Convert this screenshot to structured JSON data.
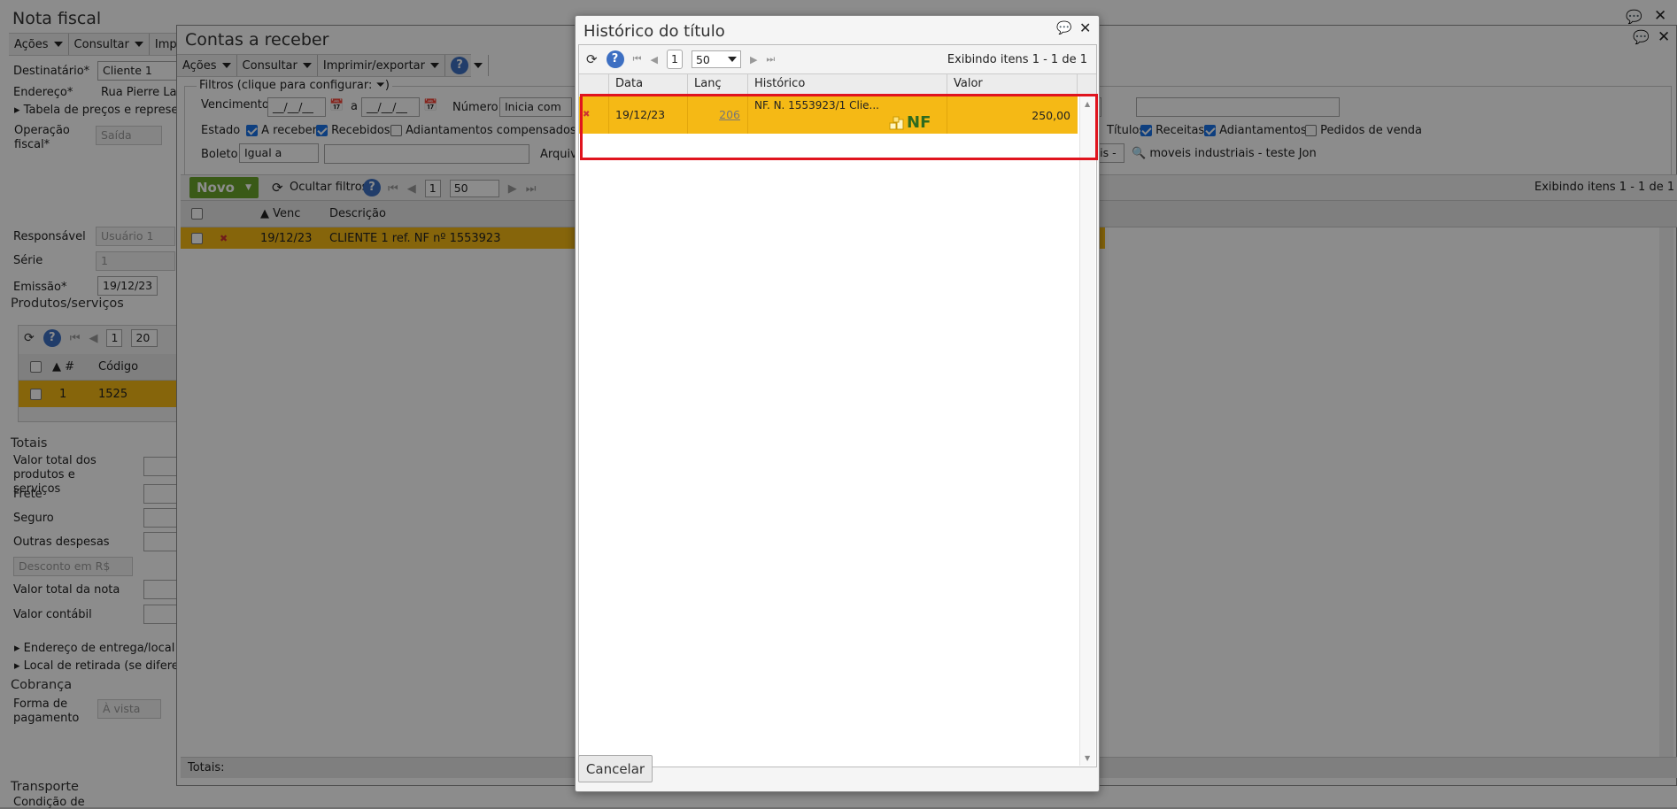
{
  "nota": {
    "title": "Nota fiscal",
    "menu": [
      "Ações",
      "Consultar",
      "Imprimir"
    ],
    "destinatario_label": "Destinatário*",
    "destinatario_value": "Cliente 1",
    "endereco_label": "Endereço*",
    "endereco_value": "Rua Pierre Laf",
    "tabela_label": "Tabela de preços e represen",
    "operacao_label": "Operação fiscal*",
    "operacao_value": "Saída",
    "responsavel_label": "Responsável",
    "responsavel_value": "Usuário 1",
    "serie_label": "Série",
    "serie_value": "1",
    "emissao_label": "Emissão*",
    "emissao_value": "19/12/23",
    "produtos_title": "Produtos/serviços",
    "prod_page": "1",
    "prod_pagesize": "20",
    "prod_col_num": "#",
    "prod_col_codigo": "Código",
    "prod_row_num": "1",
    "prod_row_codigo": "1525",
    "totais_title": "Totais",
    "valor_total_produtos_label": "Valor total dos produtos e serviços",
    "frete_label": "Frete",
    "seguro_label": "Seguro",
    "outras_label": "Outras despesas",
    "desconto_label": "Desconto em R$",
    "valor_total_nota_label": "Valor total da nota",
    "valor_contabil_label": "Valor contábil",
    "entrega_label": "Endereço de entrega/local d",
    "retirada_label": "Local de retirada (se diferen",
    "cobranca_title": "Cobrança",
    "forma_label": "Forma de pagamento",
    "forma_value": "À vista",
    "transporte_title": "Transporte",
    "condicao_label": "Condição de"
  },
  "contas": {
    "title": "Contas a receber",
    "menu": [
      "Ações",
      "Consultar",
      "Imprimir/exportar"
    ],
    "filtros_label": "Filtros (clique para configurar:",
    "vencimento_label": "Vencimento",
    "date_placeholder": "__/__/__",
    "a_label": "a",
    "numero_label": "Número",
    "numero_op": "Inicia com",
    "estado_label": "Estado",
    "estado_opts": [
      {
        "label": "A receber",
        "checked": true
      },
      {
        "label": "Recebidos",
        "checked": true
      },
      {
        "label": "Adiantamentos compensados",
        "checked": false
      }
    ],
    "right_opts": [
      {
        "label": "Títulos",
        "checked": true
      },
      {
        "label": "Receitas",
        "checked": true
      },
      {
        "label": "Adiantamentos",
        "checked": true
      },
      {
        "label": "Pedidos de venda",
        "checked": false
      }
    ],
    "boleto_label": "Boleto",
    "boleto_op": "Igual a",
    "arquivo_label": "Arquiv",
    "industriais_value": "triais -",
    "search_value": "moveis industriais - teste Jon",
    "novo_label": "Novo",
    "ocultar_label": "Ocultar filtros",
    "page": "1",
    "pagesize": "50",
    "exibindo": "Exibindo itens 1 - 1 de 1",
    "col_venc": "Venc",
    "col_descricao": "Descrição",
    "row_venc": "19/12/23",
    "row_descricao": "CLIENTE 1 ref. NF nº 1553923",
    "totais_label": "Totais:"
  },
  "dialog": {
    "title": "Histórico do título",
    "page": "1",
    "pagesize": "50",
    "exibindo": "Exibindo itens 1 - 1 de 1",
    "columns": [
      "Data",
      "Lanç",
      "Histórico",
      "Valor"
    ],
    "row": {
      "data": "19/12/23",
      "lanc": "206",
      "historico": "NF. N. 1553923/1 Clie...",
      "badge": "NF",
      "valor": "250,00"
    },
    "cancel_label": "Cancelar"
  },
  "colors": {
    "selected_row": "#f5b915",
    "highlight_box": "#e0141e",
    "novo_button": "#6aa52a",
    "help": "#3d6fc2"
  }
}
